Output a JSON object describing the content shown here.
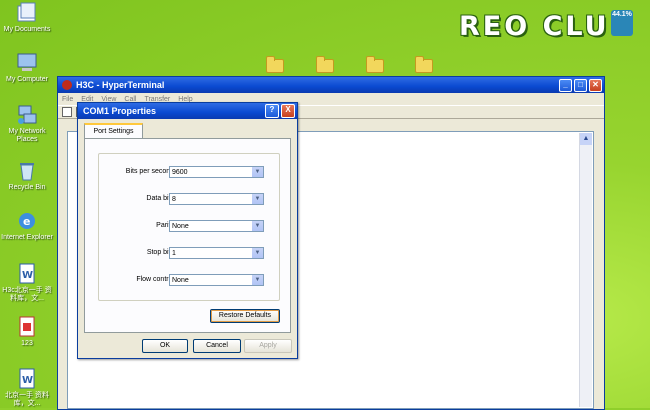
{
  "desktop": {
    "logo_text": "REO CLU",
    "logo_badge": "44.1%",
    "icons": [
      {
        "label": "My Documents"
      },
      {
        "label": "My Computer"
      },
      {
        "label": "My Network Places"
      },
      {
        "label": "Recycle Bin"
      },
      {
        "label": "Internet Explorer"
      },
      {
        "label": "H3c北京一手 资料库，文..."
      },
      {
        "label": "123"
      },
      {
        "label": "北京一手 资料库，文..."
      }
    ]
  },
  "hyperterminal": {
    "title": "H3C - HyperTerminal",
    "menu": [
      "File",
      "Edit",
      "View",
      "Call",
      "Transfer",
      "Help"
    ]
  },
  "dialog": {
    "title": "COM1 Properties",
    "help_icon": "?",
    "close_icon": "X",
    "tab": "Port Settings",
    "fields": [
      {
        "label": "Bits per second:",
        "value": "9600"
      },
      {
        "label": "Data bits:",
        "value": "8"
      },
      {
        "label": "Parity:",
        "value": "None"
      },
      {
        "label": "Stop bits:",
        "value": "1"
      },
      {
        "label": "Flow control:",
        "value": "None"
      }
    ],
    "restore_label": "Restore Defaults",
    "ok_label": "OK",
    "cancel_label": "Cancel",
    "apply_label": "Apply"
  }
}
